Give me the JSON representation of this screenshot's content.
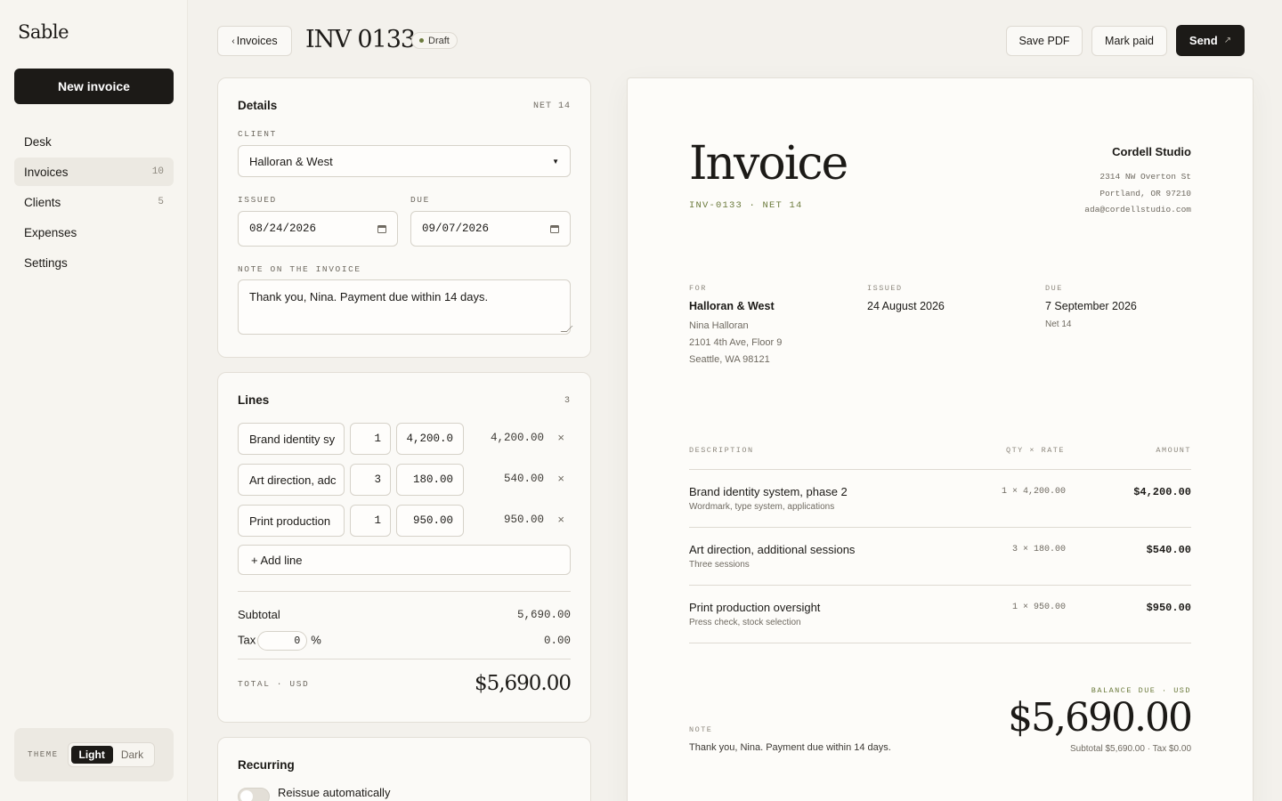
{
  "app": {
    "name": "Sable"
  },
  "sidebar": {
    "new_invoice_label": "New invoice",
    "items": [
      {
        "label": "Desk",
        "count": ""
      },
      {
        "label": "Invoices",
        "count": "10"
      },
      {
        "label": "Clients",
        "count": "5"
      },
      {
        "label": "Expenses",
        "count": ""
      },
      {
        "label": "Settings",
        "count": ""
      }
    ],
    "theme": {
      "label": "THEME",
      "options": [
        "Light",
        "Dark"
      ],
      "selected": "Light"
    }
  },
  "header": {
    "back_label": "Invoices",
    "invoice_id": "INV 0133",
    "status": "Draft",
    "save_pdf_label": "Save PDF",
    "mark_paid_label": "Mark paid",
    "send_label": "Send"
  },
  "details": {
    "title": "Details",
    "terms_tag": "NET 14",
    "client_label": "CLIENT",
    "client_value": "Halloran & West",
    "issued_label": "ISSUED",
    "issued_value": "08/24/2026",
    "due_label": "DUE",
    "due_value": "09/07/2026",
    "note_label": "NOTE ON THE INVOICE",
    "note_value": "Thank you, Nina. Payment due within 14 days."
  },
  "lines": {
    "title": "Lines",
    "count": "3",
    "items": [
      {
        "description": "Brand identity sy",
        "qty": "1",
        "rate": "4,200.0",
        "amount": "4,200.00"
      },
      {
        "description": "Art direction, adc",
        "qty": "3",
        "rate": "180.00",
        "amount": "540.00"
      },
      {
        "description": "Print production",
        "qty": "1",
        "rate": "950.00",
        "amount": "950.00"
      }
    ],
    "add_line_label": "+ Add line",
    "subtotal_label": "Subtotal",
    "subtotal_value": "5,690.00",
    "tax_label": "Tax",
    "tax_rate": "0",
    "tax_unit": "%",
    "tax_value": "0.00",
    "total_label": "TOTAL · USD",
    "total_value": "$5,690.00"
  },
  "recurring": {
    "title": "Recurring",
    "toggle_label": "Reissue automatically",
    "enabled": false
  },
  "preview": {
    "title": "Invoice",
    "subtitle": "INV-0133 · NET 14",
    "from": {
      "name": "Cordell Studio",
      "address1": "2314 NW Overton St",
      "address2": "Portland, OR 97210",
      "email": "ada@cordellstudio.com"
    },
    "for_label": "FOR",
    "for_name": "Halloran & West",
    "for_contact": "Nina Halloran",
    "for_address1": "2101 4th Ave, Floor 9",
    "for_address2": "Seattle, WA 98121",
    "issued_label": "ISSUED",
    "issued_value": "24 August 2026",
    "due_label": "DUE",
    "due_value": "7 September 2026",
    "due_terms": "Net 14",
    "col_description": "DESCRIPTION",
    "col_qty_rate": "QTY × RATE",
    "col_amount": "AMOUNT",
    "items": [
      {
        "description": "Brand identity system, phase 2",
        "sub": "Wordmark, type system, applications",
        "qty_rate": "1 × 4,200.00",
        "amount": "$4,200.00"
      },
      {
        "description": "Art direction, additional sessions",
        "sub": "Three sessions",
        "qty_rate": "3 × 180.00",
        "amount": "$540.00"
      },
      {
        "description": "Print production oversight",
        "sub": "Press check, stock selection",
        "qty_rate": "1 × 950.00",
        "amount": "$950.00"
      }
    ],
    "note_label": "NOTE",
    "note_value": "Thank you, Nina. Payment due within 14 days.",
    "balance_label": "BALANCE DUE · USD",
    "balance_value": "$5,690.00",
    "summary": "Subtotal $5,690.00 · Tax $0.00"
  },
  "colors": {
    "ink": "#1c1a17",
    "background": "#f3f1ec",
    "accent_olive": "#6b7a3c"
  }
}
